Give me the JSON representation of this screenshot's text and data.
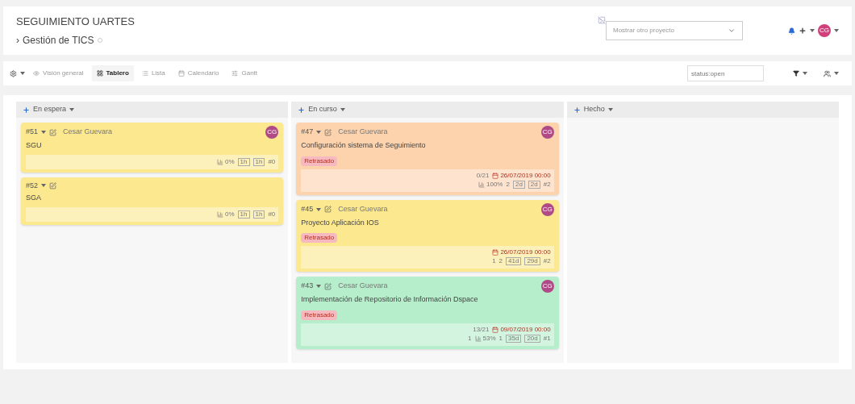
{
  "header": {
    "title": "SEGUIMIENTO UARTES",
    "breadcrumb_marker": "›",
    "breadcrumb": "Gestión de TICS",
    "project_select": {
      "placeholder": "Mostrar otro proyecto"
    },
    "avatar": "CG"
  },
  "toolbar": {
    "tabs": [
      {
        "label": "Visión general",
        "selected": false,
        "kind": "eye"
      },
      {
        "label": "Tablero",
        "selected": true,
        "kind": "board"
      },
      {
        "label": "Lista",
        "selected": false,
        "kind": "list"
      },
      {
        "label": "Calendario",
        "selected": false,
        "kind": "calendar"
      },
      {
        "label": "Gantt",
        "selected": false,
        "kind": "gantt"
      }
    ],
    "search": {
      "value": "status:open"
    }
  },
  "columns": [
    {
      "title": "En espera",
      "cards": [
        {
          "id": "#51",
          "assignee": "Cesar Guevara",
          "avatar": "CG",
          "title": "SGU",
          "color": "#fce88e",
          "footer": [
            [
              {
                "kind": "percent",
                "text": "0%"
              },
              {
                "kind": "boxed",
                "text": "1h"
              },
              {
                "kind": "boxed",
                "text": "1h"
              },
              {
                "kind": "text",
                "text": "#0"
              }
            ]
          ]
        },
        {
          "id": "#52",
          "title": "SGA",
          "color": "#fce88e",
          "footer": [
            [
              {
                "kind": "percent",
                "text": "0%"
              },
              {
                "kind": "boxed",
                "text": "1h"
              },
              {
                "kind": "boxed",
                "text": "1h"
              },
              {
                "kind": "text",
                "text": "#0"
              }
            ]
          ]
        }
      ]
    },
    {
      "title": "En curso",
      "cards": [
        {
          "id": "#47",
          "assignee": "Cesar Guevara",
          "avatar": "CG",
          "title": "Configuración sistema de Seguimiento",
          "tag": "Retrasado",
          "color": "#fdd3ae",
          "footer": [
            [
              {
                "kind": "text",
                "text": "0/21"
              },
              {
                "kind": "date",
                "text": "26/07/2019 00:00"
              }
            ],
            [
              {
                "kind": "percent",
                "text": "100%"
              },
              {
                "kind": "text",
                "text": "2"
              },
              {
                "kind": "boxed",
                "text": "2d"
              },
              {
                "kind": "boxed",
                "text": "2d"
              },
              {
                "kind": "text",
                "text": "#2"
              }
            ]
          ]
        },
        {
          "id": "#45",
          "assignee": "Cesar Guevara",
          "avatar": "CG",
          "title": "Proyecto Aplicación IOS",
          "tag": "Retrasado",
          "color": "#fce88e",
          "footer": [
            [
              {
                "kind": "date",
                "text": "26/07/2019 00:00"
              }
            ],
            [
              {
                "kind": "text",
                "text": "1"
              },
              {
                "kind": "text",
                "text": "2"
              },
              {
                "kind": "boxed",
                "text": "41d"
              },
              {
                "kind": "boxed",
                "text": "29d"
              },
              {
                "kind": "text",
                "text": "#2"
              }
            ]
          ]
        },
        {
          "id": "#43",
          "assignee": "Cesar Guevara",
          "avatar": "CG",
          "title": "Implementación de Repositorio de Información Dspace",
          "tag": "Retrasado",
          "color": "#b6eecb",
          "footer": [
            [
              {
                "kind": "text",
                "text": "13/21"
              },
              {
                "kind": "date",
                "text": "09/07/2019 00:00"
              }
            ],
            [
              {
                "kind": "text",
                "text": "1"
              },
              {
                "kind": "percent",
                "text": "53%"
              },
              {
                "kind": "text",
                "text": "1"
              },
              {
                "kind": "boxed",
                "text": "35d"
              },
              {
                "kind": "boxed",
                "text": "20d"
              },
              {
                "kind": "text",
                "text": "#1"
              }
            ]
          ]
        }
      ]
    },
    {
      "title": "Hecho"
    }
  ]
}
